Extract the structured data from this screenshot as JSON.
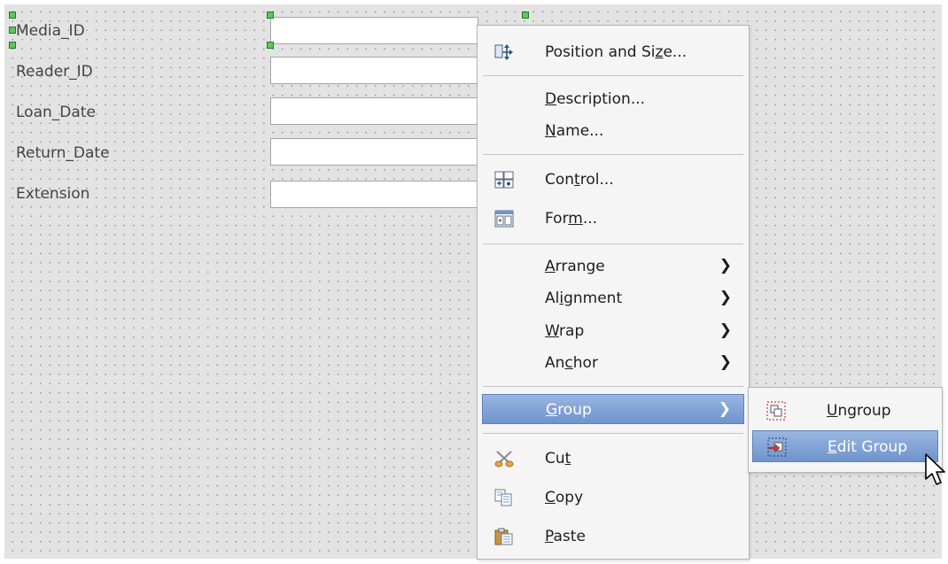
{
  "form": {
    "fields": [
      {
        "label": "Media_ID"
      },
      {
        "label": "Reader_ID"
      },
      {
        "label": "Loan_Date"
      },
      {
        "label": "Return_Date"
      },
      {
        "label": "Extension"
      }
    ]
  },
  "context_menu": {
    "items": {
      "position_size": {
        "pre": "Position and Si",
        "u": "z",
        "post": "e...",
        "icon": "position-size-icon"
      },
      "description": {
        "pre": "",
        "u": "D",
        "post": "escription...",
        "icon": ""
      },
      "name": {
        "pre": "",
        "u": "N",
        "post": "ame...",
        "icon": ""
      },
      "control": {
        "pre": "Con",
        "u": "t",
        "post": "rol...",
        "icon": "control-icon"
      },
      "form": {
        "pre": "For",
        "u": "m",
        "post": "...",
        "icon": "form-icon"
      },
      "arrange": {
        "pre": "",
        "u": "A",
        "post": "rrange",
        "icon": ""
      },
      "alignment": {
        "pre": "Al",
        "u": "i",
        "post": "gnment",
        "icon": ""
      },
      "wrap": {
        "pre": "",
        "u": "W",
        "post": "rap",
        "icon": ""
      },
      "anchor": {
        "pre": "An",
        "u": "c",
        "post": "hor",
        "icon": ""
      },
      "group": {
        "pre": "",
        "u": "G",
        "post": "roup",
        "icon": ""
      },
      "cut": {
        "pre": "Cu",
        "u": "t",
        "post": "",
        "icon": "scissors-icon"
      },
      "copy": {
        "pre": "",
        "u": "C",
        "post": "opy",
        "icon": "copy-icon"
      },
      "paste": {
        "pre": "",
        "u": "P",
        "post": "aste",
        "icon": "paste-icon"
      }
    },
    "submenu_arrow": "❯"
  },
  "group_submenu": {
    "ungroup": {
      "pre": "",
      "u": "U",
      "post": "ngroup",
      "icon": "ungroup-icon"
    },
    "edit_group": {
      "pre": "",
      "u": "E",
      "post": "dit Group",
      "icon": "edit-group-icon"
    }
  },
  "colors": {
    "highlight": "#7a9bd2",
    "canvas": "#e3e3e3",
    "handle": "#5cc85c"
  }
}
